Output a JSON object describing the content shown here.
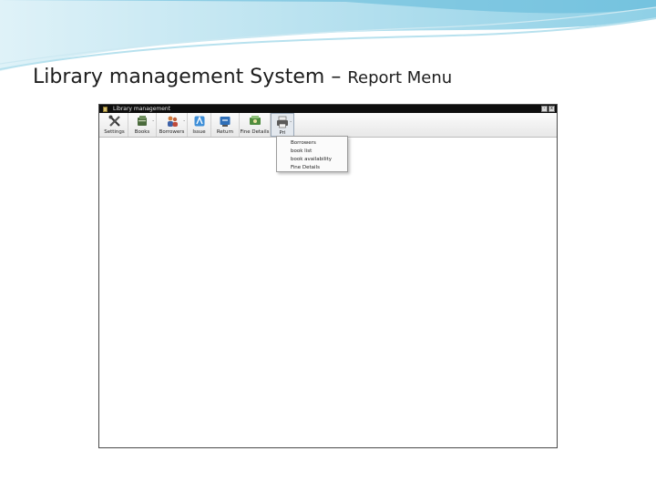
{
  "slide": {
    "title_main": "Library management System",
    "title_separator": "–",
    "title_sub": "Report Menu"
  },
  "window": {
    "title": "Library management",
    "controls": {
      "minimize": "-",
      "close": "x"
    }
  },
  "toolbar": {
    "items": [
      {
        "label": "Settings",
        "icon": "tools-icon",
        "has_arrow": false
      },
      {
        "label": "Books",
        "icon": "books-icon",
        "has_arrow": true
      },
      {
        "label": "Borrowers",
        "icon": "users-icon",
        "has_arrow": true
      },
      {
        "label": "Issue",
        "icon": "issue-icon",
        "has_arrow": false
      },
      {
        "label": "Return",
        "icon": "return-icon",
        "has_arrow": false
      },
      {
        "label": "Fine Details",
        "icon": "fine-icon",
        "has_arrow": false
      },
      {
        "label": "Pri",
        "icon": "printer-icon",
        "has_arrow": true
      }
    ]
  },
  "report_menu": {
    "items": [
      "Borrowers",
      "book list",
      "book availability",
      "Fine Details"
    ]
  },
  "colors": {
    "titlebar": "#0d0d0d",
    "accent_wave": "#7cc6e0"
  }
}
